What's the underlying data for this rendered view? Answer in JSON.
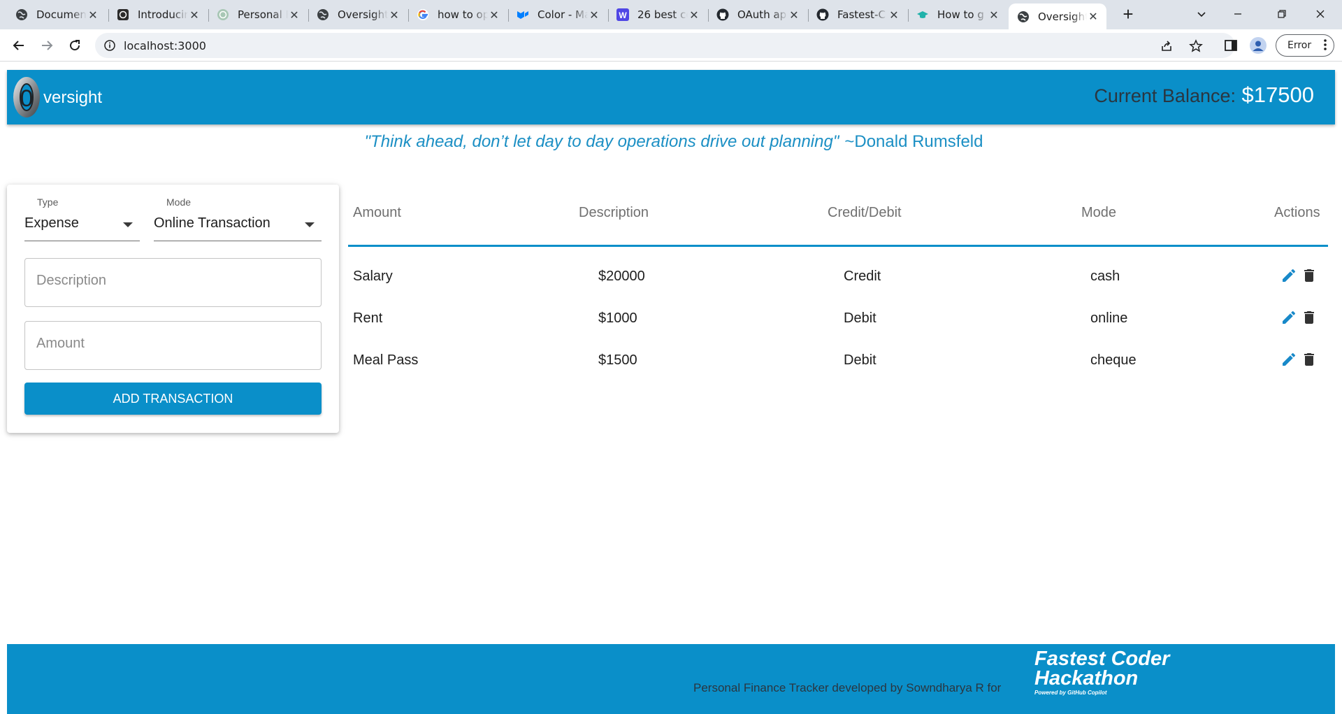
{
  "browser": {
    "tabs": [
      {
        "label": "Documen",
        "icon": "globe-icon"
      },
      {
        "label": "Introducin",
        "icon": "openai-icon"
      },
      {
        "label": "Personal F",
        "icon": "chatgpt-icon"
      },
      {
        "label": "Oversight",
        "icon": "globe-icon"
      },
      {
        "label": "how to op",
        "icon": "google-icon"
      },
      {
        "label": "Color - Ma",
        "icon": "mui-icon"
      },
      {
        "label": "26 best co",
        "icon": "w-icon"
      },
      {
        "label": "OAuth ap",
        "icon": "github-icon"
      },
      {
        "label": "Fastest-C",
        "icon": "github-icon"
      },
      {
        "label": "How to g",
        "icon": "teal-icon"
      },
      {
        "label": "Oversight",
        "icon": "globe-icon",
        "active": true
      }
    ],
    "url": "localhost:3000",
    "profile_button": "Error",
    "new_tab_symbol": "+"
  },
  "header": {
    "logo_letter": "0",
    "app_name": "versight",
    "balance_label": "Current Balance:",
    "balance_value": "$17500"
  },
  "quote": {
    "text": "\"Think ahead, don’t let day to day operations drive out planning\"",
    "author": "~Donald Rumsfeld"
  },
  "form": {
    "type_label": "Type",
    "type_value": "Expense",
    "mode_label": "Mode",
    "mode_value": "Online Transaction",
    "description_placeholder": "Description",
    "amount_placeholder": "Amount",
    "submit_label": "ADD TRANSACTION"
  },
  "table": {
    "headers": [
      "Amount",
      "Description",
      "Credit/Debit",
      "Mode",
      "Actions"
    ],
    "rows": [
      {
        "name": "Salary",
        "amount": "$20000",
        "type": "Credit",
        "mode": "cash"
      },
      {
        "name": "Rent",
        "amount": "$1000",
        "type": "Debit",
        "mode": "online"
      },
      {
        "name": "Meal Pass",
        "amount": "$1500",
        "type": "Debit",
        "mode": "cheque"
      }
    ]
  },
  "footer": {
    "credit": "Personal Finance Tracker developed by Sowndharya R for",
    "hackathon_line1": "Fastest Coder",
    "hackathon_line2": "Hackathon",
    "powered_by": "Powered by GitHub Copilot"
  },
  "colors": {
    "primary": "#0a8fc9",
    "edit_icon": "#1889c9",
    "delete_icon": "#333333"
  }
}
